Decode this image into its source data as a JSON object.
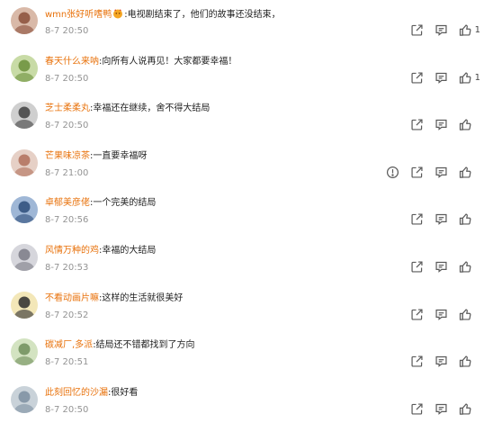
{
  "comments": [
    {
      "username": "wmn张好听嗜鸭",
      "text": ":电视剧结束了，他们的故事还没结束，",
      "time": "8-7 20:50",
      "likes": "1",
      "badge": true,
      "actions": [
        "share",
        "comment",
        "like"
      ],
      "avatar": {
        "bg": "#d9b9a8",
        "fg": "#8a4f3a"
      }
    },
    {
      "username": "春天什么来呐",
      "text": ":向所有人说再见！大家都要幸福！",
      "time": "8-7 20:50",
      "likes": "1",
      "badge": false,
      "actions": [
        "share",
        "comment",
        "like"
      ],
      "avatar": {
        "bg": "#c8dba6",
        "fg": "#6b8f3a"
      }
    },
    {
      "username": "芝士柔柔丸",
      "text": ":幸福还在继续，舍不得大结局",
      "time": "8-7 20:50",
      "likes": "",
      "badge": false,
      "actions": [
        "share",
        "comment",
        "like"
      ],
      "avatar": {
        "bg": "#cfcfcf",
        "fg": "#3f3f3f"
      }
    },
    {
      "username": "芒果味凉茶",
      "text": ":一直要幸福呀",
      "time": "8-7 21:00",
      "likes": "",
      "badge": false,
      "actions": [
        "report",
        "share",
        "comment",
        "like"
      ],
      "avatar": {
        "bg": "#e6d0c6",
        "fg": "#b0705a"
      }
    },
    {
      "username": "卓郁美彦佬",
      "text": ":一个完美的结局",
      "time": "8-7 20:56",
      "likes": "",
      "badge": false,
      "actions": [
        "share",
        "comment",
        "like"
      ],
      "avatar": {
        "bg": "#9fb7d6",
        "fg": "#2d4d7a"
      }
    },
    {
      "username": "风情万种的鸡",
      "text": ":幸福的大结局",
      "time": "8-7 20:53",
      "likes": "",
      "badge": false,
      "actions": [
        "share",
        "comment",
        "like"
      ],
      "avatar": {
        "bg": "#d6d6dc",
        "fg": "#7b7b86"
      }
    },
    {
      "username": "不看动画片嘛",
      "text": ":这样的生活就很美好",
      "time": "8-7 20:52",
      "likes": "",
      "badge": false,
      "actions": [
        "share",
        "comment",
        "like"
      ],
      "avatar": {
        "bg": "#f3e7b8",
        "fg": "#2b2b2b"
      }
    },
    {
      "username": "碳减厂,多派",
      "text": ":结局还不错都找到了方向",
      "time": "8-7 20:51",
      "likes": "",
      "badge": false,
      "actions": [
        "share",
        "comment",
        "like"
      ],
      "avatar": {
        "bg": "#d3e3c1",
        "fg": "#6f8e5a"
      }
    },
    {
      "username": "此刻回忆的沙漏",
      "text": ":很好看",
      "time": "8-7 20:50",
      "likes": "",
      "badge": false,
      "actions": [
        "share",
        "comment",
        "like"
      ],
      "avatar": {
        "bg": "#c9d2d9",
        "fg": "#7d8fa0"
      }
    }
  ],
  "colors": {
    "username": "#e8710a",
    "time": "#939393",
    "icon": "#5a5a5a"
  }
}
